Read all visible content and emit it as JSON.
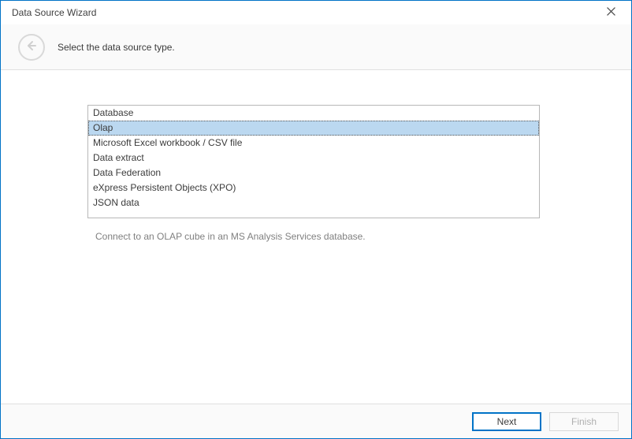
{
  "window": {
    "title": "Data Source Wizard"
  },
  "header": {
    "instruction": "Select the data source type."
  },
  "list": {
    "items": [
      "Database",
      "Olap",
      "Microsoft Excel workbook / CSV file",
      "Data extract",
      "Data Federation",
      "eXpress Persistent Objects (XPO)",
      "JSON data"
    ],
    "selectedIndex": 1
  },
  "description": "Connect to an OLAP cube in an MS Analysis Services database.",
  "footer": {
    "next": "Next",
    "finish": "Finish"
  }
}
